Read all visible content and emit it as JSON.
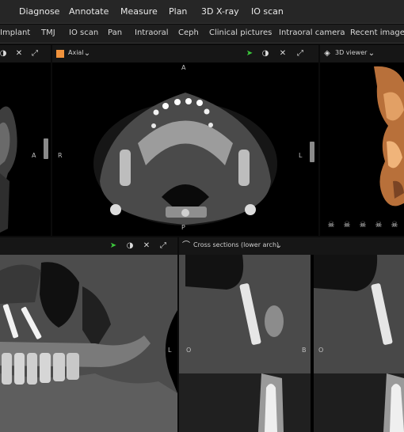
{
  "menu": [
    "Diagnose",
    "Annotate",
    "Measure",
    "Plan",
    "3D X-ray",
    "IO scan"
  ],
  "tabs": [
    "Implant",
    "TMJ",
    "IO scan",
    "Pan",
    "Intraoral",
    "Ceph",
    "Clinical pictures",
    "Intraoral camera",
    "Recent images"
  ],
  "panels": {
    "left_top": {
      "orientation_label": "A"
    },
    "axial": {
      "title": "Axial",
      "color_swatch": "#f0923c",
      "labels": {
        "top": "A",
        "bottom": "P",
        "left": "R",
        "right": "L"
      }
    },
    "viewer3d": {
      "title": "3D viewer",
      "orientation_icons": [
        "skull-front-icon",
        "skull-left-icon",
        "skull-right-icon",
        "skull-top-icon",
        "skull-bottom-icon",
        "skull-back-icon"
      ]
    },
    "panoramic": {
      "right_label": "L"
    },
    "cross_sections": {
      "title": "Cross sections (lower arch)",
      "slice1": {
        "left_label": "O",
        "right_label": "B"
      },
      "slice2": {
        "left_label": "O"
      }
    }
  },
  "colors": {
    "accent_green": "#3cc83c",
    "axial_swatch": "#f0923c",
    "bone_tint": "#d9884a"
  }
}
